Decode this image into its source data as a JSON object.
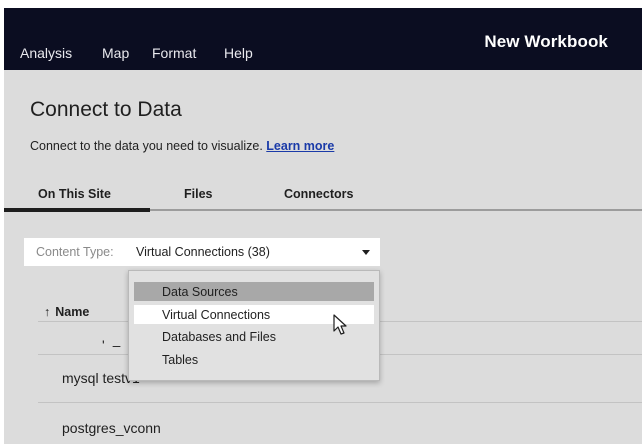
{
  "menu": {
    "items": [
      {
        "label": "Analysis"
      },
      {
        "label": "Map"
      },
      {
        "label": "Format"
      },
      {
        "label": "Help"
      }
    ],
    "workbook_title": "New Workbook"
  },
  "header": {
    "title": "Connect to Data",
    "subtitle": "Connect to the data you need to visualize.",
    "learn_more": "Learn more"
  },
  "tabs": [
    {
      "label": "On This Site",
      "active": true
    },
    {
      "label": "Files",
      "active": false
    },
    {
      "label": "Connectors",
      "active": false
    }
  ],
  "content_type": {
    "label": "Content Type:",
    "value": "Virtual Connections (38)"
  },
  "table": {
    "sort_arrow": "↑",
    "name_header": "Name",
    "partial_row": "'  –",
    "rows": [
      {
        "name": "mysql testv1"
      },
      {
        "name": "postgres_vconn"
      }
    ]
  },
  "dropdown": {
    "options": [
      {
        "label": "Data Sources",
        "state": "highlighted"
      },
      {
        "label": "Virtual Connections",
        "state": "hover"
      },
      {
        "label": "Databases and Files",
        "state": "normal"
      },
      {
        "label": "Tables",
        "state": "normal"
      }
    ]
  },
  "colors": {
    "topbar": "#0b0d21",
    "background": "#dcdcdc",
    "link": "#1a3aa8",
    "dropdown_highlight": "#a8a8a8",
    "dropdown_hover": "#ffffff"
  },
  "icons": {
    "cursor": "mouse-pointer-icon",
    "caret": "chevron-down-icon",
    "sort": "sort-ascending-icon"
  }
}
